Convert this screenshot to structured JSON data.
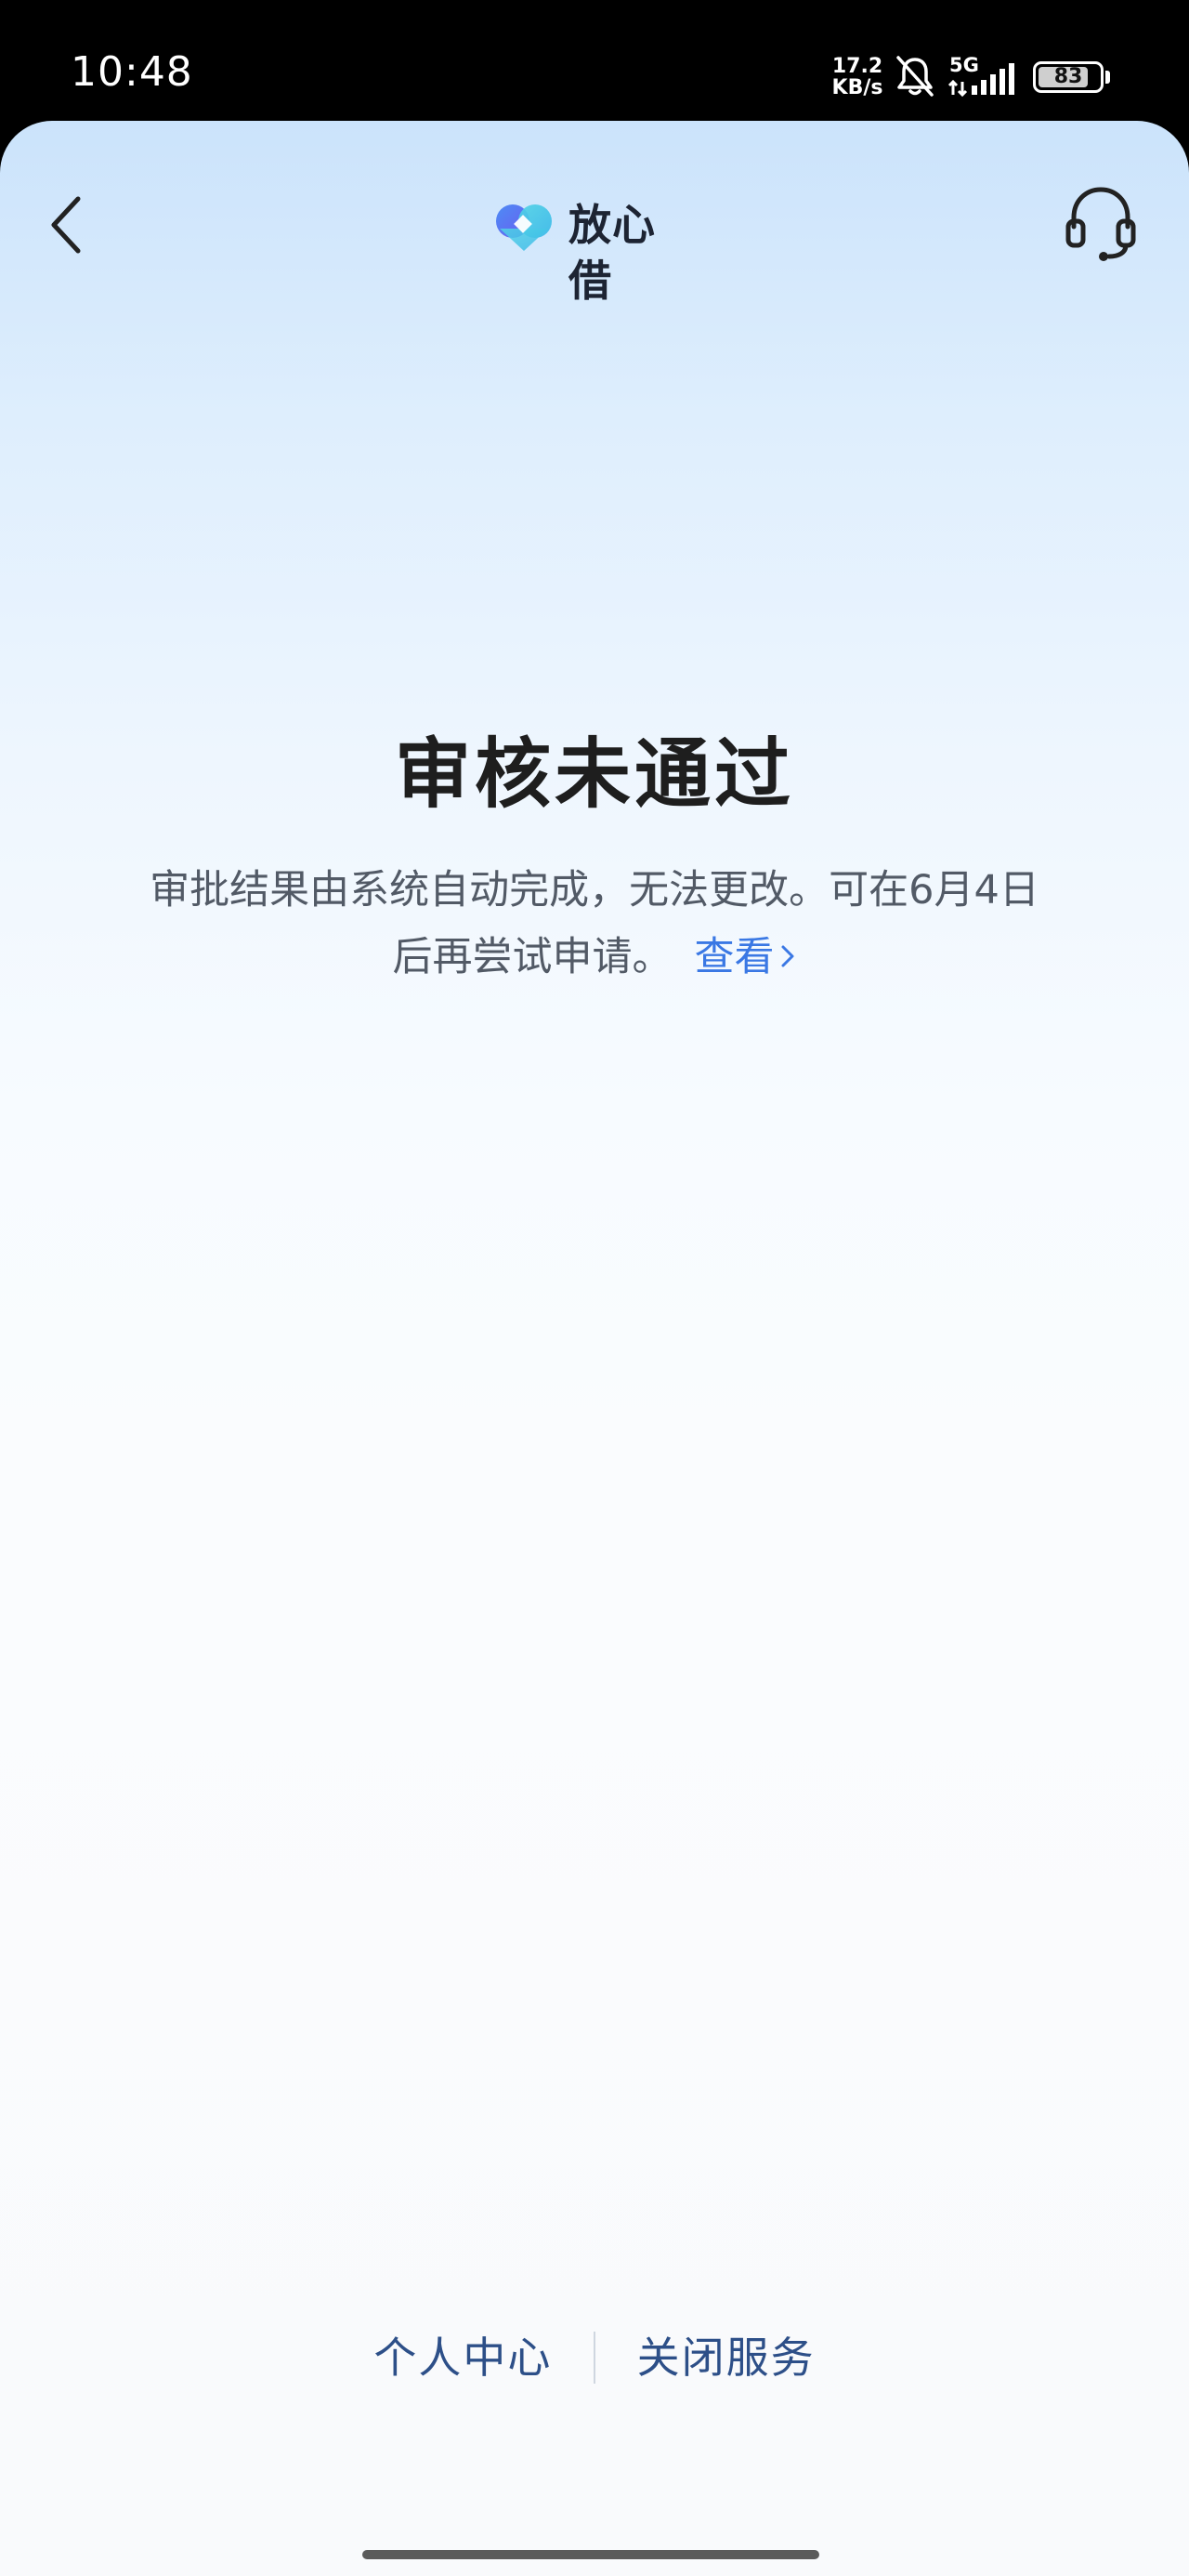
{
  "status_bar": {
    "time": "10:48",
    "net_speed_value": "17.2",
    "net_speed_unit": "KB/s",
    "signal_label": "5G",
    "battery_level": "83",
    "battery_fraction": 0.83
  },
  "header": {
    "brand_name": "放心借",
    "back_icon": "chevron-left-icon",
    "service_icon": "headset-icon"
  },
  "result": {
    "title": "审核未通过",
    "description": "审批结果由系统自动完成，无法更改。可在6月4日后再尝试申请。",
    "view_link": "查看"
  },
  "footer": {
    "personal_center": "个人中心",
    "close_service": "关闭服务"
  },
  "colors": {
    "accent_link": "#3a78e4",
    "footer_link": "#2d4f88",
    "title_text": "#1e1e1e"
  }
}
